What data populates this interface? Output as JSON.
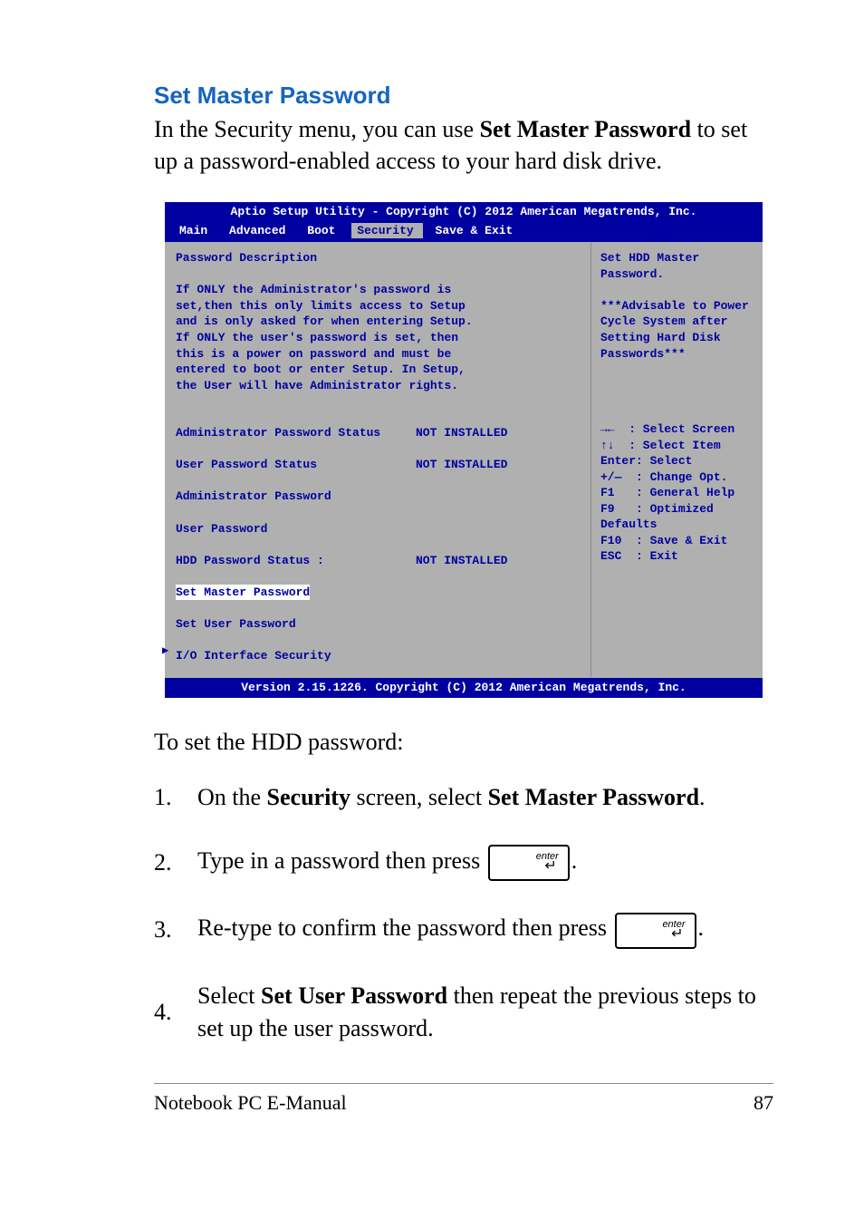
{
  "heading": "Set Master Password",
  "intro_pre": "In the Security menu, you can use ",
  "intro_bold": "Set Master Password",
  "intro_post": " to set up a password-enabled access to your hard disk drive.",
  "bios": {
    "header": "Aptio Setup Utility - Copyright (C) 2012 American Megatrends, Inc.",
    "tabs": {
      "main": "Main",
      "advanced": "Advanced",
      "boot": "Boot",
      "security": "Security",
      "save": "Save & Exit"
    },
    "left": {
      "title": "Password Description",
      "desc1": "If ONLY the Administrator's password is",
      "desc2": "set,then this only limits access to Setup",
      "desc3": "and is only asked for when entering Setup.",
      "desc4": "If ONLY the user's password is set, then",
      "desc5": "this is a power on password and must be",
      "desc6": "entered to boot or enter Setup. In Setup,",
      "desc7": "the User will have Administrator rights.",
      "admin_status_lbl": "Administrator Password Status",
      "admin_status_val": "NOT INSTALLED",
      "user_status_lbl": "User Password Status",
      "user_status_val": "NOT INSTALLED",
      "admin_pw": "Administrator Password",
      "user_pw": "User Password",
      "hdd_status_lbl": "HDD Password Status :",
      "hdd_status_val": "NOT INSTALLED",
      "set_master": "Set Master Password",
      "set_user": "Set User Password",
      "io": "I/O Interface Security"
    },
    "right": {
      "help1": "Set HDD Master Password.",
      "help2": "***Advisable to Power Cycle System after Setting Hard Disk Passwords***",
      "k1": "→←  : Select Screen",
      "k2": "↑↓  : Select Item",
      "k3": "Enter: Select",
      "k4": "+/—  : Change Opt.",
      "k5": "F1   : General Help",
      "k6": "F9   : Optimized ",
      "k7": "Defaults",
      "k8": "F10  : Save & Exit",
      "k9": "ESC  : Exit"
    },
    "footer": "Version 2.15.1226. Copyright (C) 2012 American Megatrends, Inc."
  },
  "after_bios": "To set the HDD password:",
  "steps": {
    "s1_pre": "On the ",
    "s1_b1": "Security",
    "s1_mid": " screen, select ",
    "s1_b2": "Set Master Password",
    "s1_post": ".",
    "s2": "Type in a password then press ",
    "s3": "Re-type to confirm the password then press ",
    "s4_pre": "Select ",
    "s4_b": "Set User Password",
    "s4_post": " then repeat the previous steps to set up the user password."
  },
  "key_label": "enter",
  "footer": {
    "left": "Notebook PC E-Manual",
    "right": "87"
  }
}
